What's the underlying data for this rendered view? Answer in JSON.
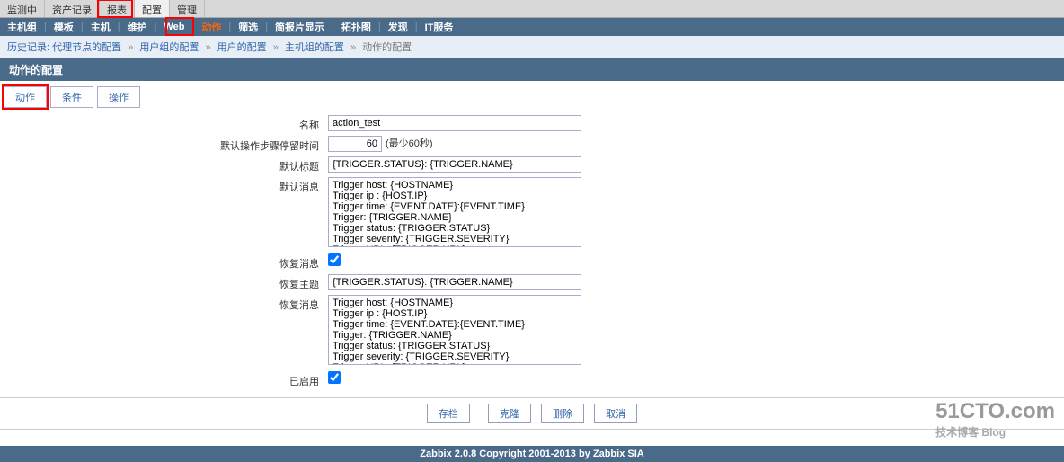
{
  "top_menu": {
    "items": [
      "监测中",
      "资产记录",
      "报表",
      "配置",
      "管理"
    ]
  },
  "sub_menu": {
    "items": [
      "主机组",
      "模板",
      "主机",
      "维护",
      "Web",
      "动作",
      "筛选",
      "简报片显示",
      "拓扑图",
      "发现",
      "IT服务"
    ]
  },
  "breadcrumb": {
    "label": "历史记录:",
    "items": [
      "代理节点的配置",
      "用户组的配置",
      "用户的配置",
      "主机组的配置",
      "动作的配置"
    ]
  },
  "page_title": "动作的配置",
  "tabs": {
    "items": [
      "动作",
      "条件",
      "操作"
    ]
  },
  "form": {
    "name_label": "名称",
    "name_value": "action_test",
    "step_label": "默认操作步骤停留时间",
    "step_value": "60",
    "step_hint": "(最少60秒)",
    "subject_label": "默认标题",
    "subject_value": "{TRIGGER.STATUS}: {TRIGGER.NAME}",
    "message_label": "默认消息",
    "message_value": "Trigger host: {HOSTNAME}\nTrigger ip : {HOST.IP}\nTrigger time: {EVENT.DATE}:{EVENT.TIME}\nTrigger: {TRIGGER.NAME}\nTrigger status: {TRIGGER.STATUS}\nTrigger severity: {TRIGGER.SEVERITY}\nTrigger URL: {TRIGGER.URL}",
    "recovery_msg_label": "恢复消息",
    "recovery_subject_label": "恢复主题",
    "recovery_subject_value": "{TRIGGER.STATUS}: {TRIGGER.NAME}",
    "recovery_message_label": "恢复消息",
    "recovery_message_value": "Trigger host: {HOSTNAME}\nTrigger ip : {HOST.IP}\nTrigger time: {EVENT.DATE}:{EVENT.TIME}\nTrigger: {TRIGGER.NAME}\nTrigger status: {TRIGGER.STATUS}\nTrigger severity: {TRIGGER.SEVERITY}\nTrigger URL: {TRIGGER.URL}",
    "enabled_label": "已启用"
  },
  "buttons": {
    "save": "存档",
    "clone": "克隆",
    "delete": "删除",
    "cancel": "取消"
  },
  "footer": "Zabbix 2.0.8 Copyright 2001-2013 by Zabbix SIA",
  "watermark": {
    "main": "51CTO.com",
    "sub": "技术博客  Blog"
  }
}
